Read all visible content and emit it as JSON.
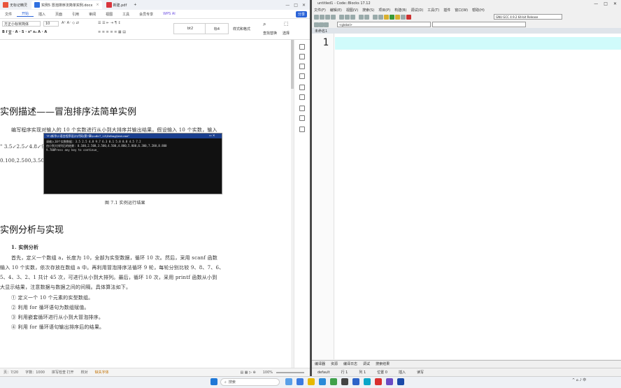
{
  "wps": {
    "tabs": [
      "无标记精灵",
      "实例5 冒泡排序法简单实例.docx",
      "新建.pdf"
    ],
    "new_tab": "+",
    "menu": [
      "文件",
      "开始",
      "插入",
      "页面",
      "引用",
      "审阅",
      "视图",
      "工具",
      "会员专享",
      "WPS AI"
    ],
    "share": "分享",
    "ribbon": {
      "font_name": "方正小标宋简体",
      "font_size": "10",
      "style1": "bt2",
      "style2": "标4",
      "more_styles": "样式和格式",
      "find": "查找替换",
      "select": "选择"
    },
    "doc": {
      "heading1": "实例描述——冒泡排序法简单实例",
      "para1": "编写程序实现对输入的 10 个实数进行从小到大排序并输出结果。假设输入 10 个实数，输入",
      "para2": "\" 3.5↙2.5↙4.8↙9.7↙6.3↙0.1↙5.8↙8.8↙4.5↙7.2↙ \"， 那 么 输 出 结 果 为",
      "para3": "0.100,2.500,3.500,4.500,4.800, 5.800,6.300,7.200,8.800,9.700\"，如图 7.1 所示。",
      "console_title": "\"F:\\新华\\C语言程序设计\\代码\\第7章\\code7_23\\Debug\\test.exe\"",
      "console_lines": [
        "请输入10个实数数据: 3.5 2.5 4.8 9.7 6.3 0.1 5.8 8.8 4.5 7.2",
        "由小到大排列后的结果: 0.100,2.500,3.500,4.500,4.800,5.800,6.300,7.200,8.800",
        "9.700Press any key to continue_"
      ],
      "caption": "图 7.1   实例运行结果",
      "heading2": "实例分析与实现",
      "sub1": "1. 实例分析",
      "para4": "首先，定义一个数组 a，长度为 10，全部为实型数据，循环 10 次。然后，采用 scanf 函数",
      "para5": "输入 10 个实数，依次存放在数组 a 中。再利用冒泡排序法循环 9 轮，每轮分别比较 9、8、7、6、",
      "para6": "5、4、3、2、1 共计 45 次，可进行从小到大排列。最后，循环 10 次，采用 printf 函数从小到",
      "para7": "大显示结果，注意数据与数据之间的间隔。具体算法如下。",
      "step1": "①  定义一个 10 个元素的实型数组。",
      "step2": "②  利用 for 循环语句为数组赋值。",
      "step3": "③  利用嵌套循环进行从小到大冒泡排序。",
      "step4": "④  利用 for 循环语句输出排序后的结果。"
    },
    "status": {
      "page": "页：7/20",
      "words": "字数：1000",
      "spell": "拼写检查 打开",
      "proof": "校对",
      "missing": "缺失字体",
      "zoom": "100%"
    }
  },
  "cb": {
    "title": "untitled1 - Code::Blocks 17.12",
    "menu": [
      "文件(F)",
      "编辑(E)",
      "视图(V)",
      "搜索(S)",
      "项目(P)",
      "构建(B)",
      "调试(D)",
      "工具(T)",
      "插件",
      "窗口(W)",
      "帮助(H)"
    ],
    "build_target": "GNU GCC 4.9.2 64-bit Release",
    "scope": "<global>",
    "file_tab": "未命名1",
    "line_no": "1",
    "logs": [
      "编译器",
      "资源",
      "编译日志",
      "调试",
      "搜索结果"
    ],
    "status": {
      "line": "行 1",
      "col": "列 1",
      "pos": "位置 0",
      "insert": "插入",
      "access": "读写",
      "enc": "default"
    }
  },
  "taskbar": {
    "search_placeholder": "搜索",
    "time": "",
    "ime": "中"
  }
}
